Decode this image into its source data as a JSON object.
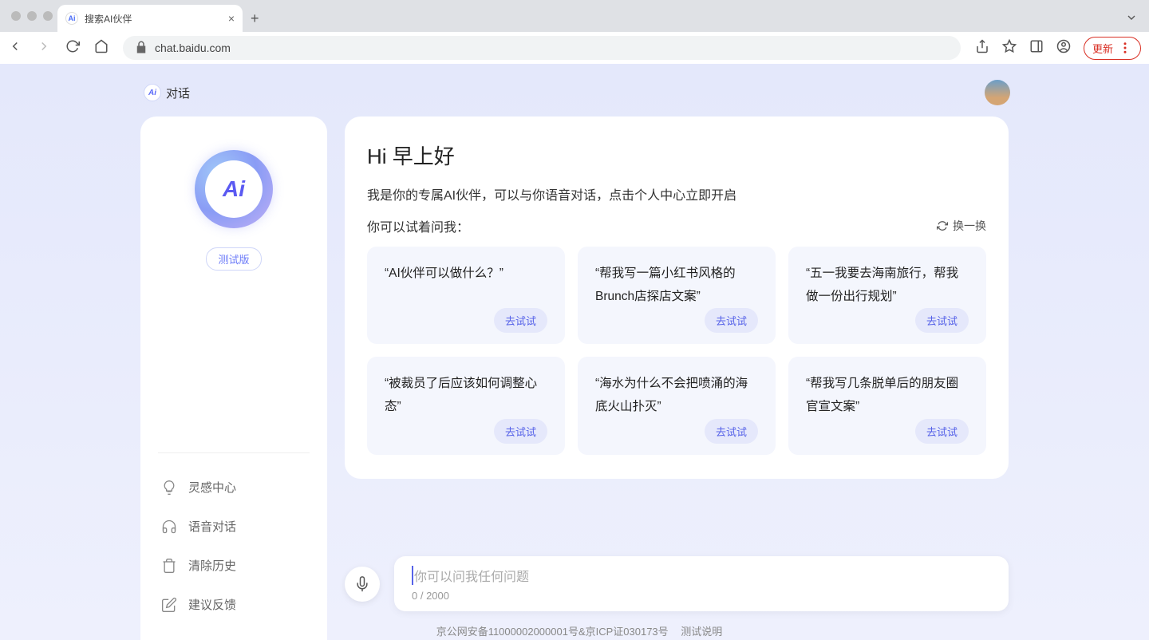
{
  "browser": {
    "tab_title": "搜索AI伙伴",
    "url_host": "chat.baidu.com",
    "update_label": "更新"
  },
  "header": {
    "title": "对话",
    "ai_badge": "Ai"
  },
  "sidebar": {
    "logo_text": "Ai",
    "beta_label": "测试版",
    "menu": [
      {
        "label": "灵感中心"
      },
      {
        "label": "语音对话"
      },
      {
        "label": "清除历史"
      },
      {
        "label": "建议反馈"
      }
    ]
  },
  "main": {
    "greeting": "Hi 早上好",
    "subtitle": "我是你的专属AI伙伴，可以与你语音对话，点击个人中心立即开启",
    "try_label": "你可以试着问我：",
    "refresh_label": "换一换",
    "try_btn_label": "去试试",
    "prompts": [
      "“AI伙伴可以做什么？”",
      "“帮我写一篇小红书风格的Brunch店探店文案”",
      "“五一我要去海南旅行，帮我做一份出行规划”",
      "“被裁员了后应该如何调整心态”",
      "“海水为什么不会把喷涌的海底火山扑灭”",
      "“帮我写几条脱单后的朋友圈官宣文案”"
    ]
  },
  "input": {
    "placeholder": "你可以问我任何问题",
    "count": "0",
    "max": "2000"
  },
  "footer": {
    "license": "京公网安备11000002000001号&京ICP证030173号",
    "test_note": "测试说明"
  }
}
